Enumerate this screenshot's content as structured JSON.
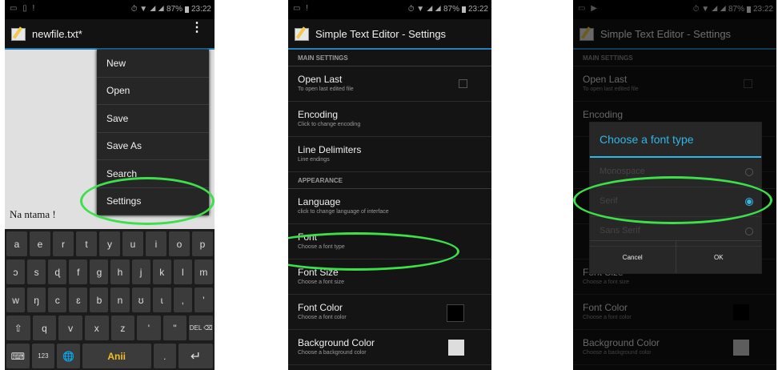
{
  "status": {
    "battery": "87%",
    "time": "23:22"
  },
  "phone1": {
    "title": "newfile.txt*",
    "editor_text": "Na ntama !",
    "menu": [
      "New",
      "Open",
      "Save",
      "Save As",
      "Search",
      "Settings"
    ],
    "keyboard": {
      "row1": [
        "a",
        "e",
        "r",
        "t",
        "y",
        "u",
        "i",
        "o",
        "p"
      ],
      "row2": [
        "ɔ",
        "s",
        "ɖ",
        "f",
        "g",
        "h",
        "j",
        "k",
        "l",
        "m"
      ],
      "row3": [
        "w",
        "ŋ",
        "c",
        "ɛ",
        "b",
        "n",
        "ʊ",
        "ɩ",
        ",",
        "'"
      ],
      "row4": [
        "⇧",
        "q",
        "v",
        "x",
        "z",
        "'",
        "\"",
        "DEL ⌫"
      ],
      "row5": [
        "⌨",
        "123",
        "🌐",
        "Anii",
        ".",
        "↵"
      ]
    }
  },
  "settings": {
    "app_title": "Simple Text Editor - Settings",
    "main_header": "MAIN SETTINGS",
    "appearance_header": "APPEARANCE",
    "open_last": {
      "title": "Open Last",
      "subtitle": "To open last edited file"
    },
    "encoding": {
      "title": "Encoding",
      "subtitle": "Click to change encoding"
    },
    "line_delimiters": {
      "title": "Line Delimiters",
      "subtitle": "Line endings"
    },
    "language": {
      "title": "Language",
      "subtitle": "click to change language of interface"
    },
    "font": {
      "title": "Font",
      "subtitle": "Choose a font type"
    },
    "font_size": {
      "title": "Font Size",
      "subtitle": "Choose a font size"
    },
    "font_color": {
      "title": "Font Color",
      "subtitle": "Choose a font color"
    },
    "background_color": {
      "title": "Background Color",
      "subtitle": "Choose a background color"
    },
    "font_color_value": "#000000",
    "background_color_value": "#dddddd"
  },
  "dialog": {
    "title": "Choose a font type",
    "options": [
      "Monospace",
      "Serif",
      "Sans Serif"
    ],
    "selected": "Serif",
    "cancel": "Cancel",
    "ok": "OK"
  },
  "colors": {
    "accent": "#33b5e5",
    "highlight": "#3de04a"
  }
}
